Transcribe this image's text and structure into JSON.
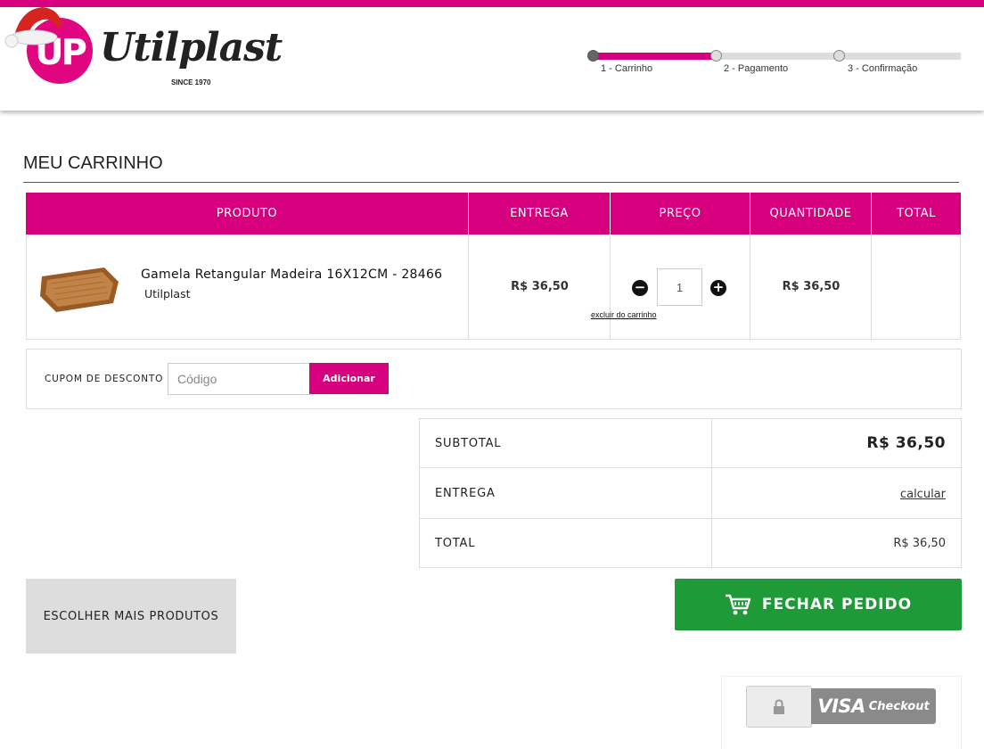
{
  "brand": {
    "logo_mark": "UP",
    "logo_word": "Utilplast",
    "since": "SINCE 1970",
    "accent_color": "#d6007f"
  },
  "steps": [
    {
      "label": "1 - Carrinho",
      "state": "done"
    },
    {
      "label": "2 - Pagamento",
      "state": "pending"
    },
    {
      "label": "3 - Confirmação",
      "state": "pending"
    }
  ],
  "page_title": "MEU CARRINHO",
  "table": {
    "headers": [
      "PRODUTO",
      "ENTREGA",
      "PREÇO",
      "QUANTIDADE",
      "TOTAL"
    ]
  },
  "item": {
    "name": "Gamela Retangular Madeira 16X12CM - 28466",
    "brand": "Utilplast",
    "delivery_price": "R$ 36,50",
    "quantity": "1",
    "remove_label": "excluir do carrinho",
    "unit_total": "R$ 36,50"
  },
  "coupon": {
    "label": "CUPOM DE DESCONTO",
    "placeholder": "Código",
    "button": "Adicionar"
  },
  "totals": {
    "subtotal_label": "SUBTOTAL",
    "subtotal_value": "R$ 36,50",
    "delivery_label": "ENTREGA",
    "delivery_value": "calcular",
    "total_label": "TOTAL",
    "total_value": "R$ 36,50"
  },
  "actions": {
    "more_products": "ESCOLHER MAIS PRODUTOS",
    "checkout": "FECHAR PEDIDO",
    "checkout_color": "#1e9a39"
  },
  "visa": {
    "word": "VISA",
    "suffix": "Checkout"
  },
  "icons": [
    "santa-hat-icon",
    "minus-icon",
    "plus-icon",
    "cart-icon",
    "lock-icon"
  ]
}
